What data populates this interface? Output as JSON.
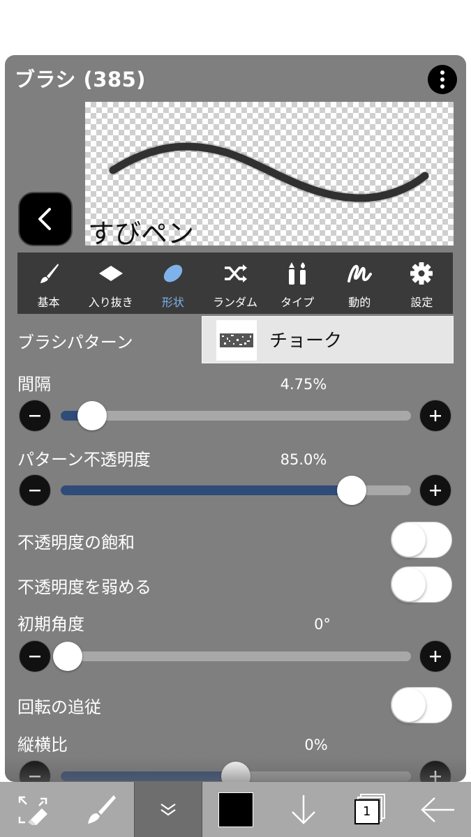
{
  "header": {
    "title": "ブラシ (385)"
  },
  "preview": {
    "brush_name": "すびペン"
  },
  "tabs": [
    {
      "label": "基本",
      "icon": "brush-icon",
      "active": false
    },
    {
      "label": "入り抜き",
      "icon": "diamond-icon",
      "active": false
    },
    {
      "label": "形状",
      "icon": "ellipse-icon",
      "active": true
    },
    {
      "label": "ランダム",
      "icon": "shuffle-icon",
      "active": false
    },
    {
      "label": "タイプ",
      "icon": "type-icon",
      "active": false
    },
    {
      "label": "動的",
      "icon": "dynamic-icon",
      "active": false
    },
    {
      "label": "設定",
      "icon": "gear-icon",
      "active": false
    }
  ],
  "brush_pattern": {
    "label": "ブラシパターン",
    "value": "チョーク"
  },
  "spacing": {
    "label": "間隔",
    "value": "4.75%",
    "level": 0.09
  },
  "pattern_opacity": {
    "label": "パターン不透明度",
    "value": "85.0%",
    "level": 0.83
  },
  "opacity_saturation": {
    "label": "不透明度の飽和",
    "on": false
  },
  "opacity_weaken": {
    "label": "不透明度を弱める",
    "on": false
  },
  "initial_angle": {
    "label": "初期角度",
    "value": "0°",
    "level": 0.02
  },
  "follow_rotation": {
    "label": "回転の追従",
    "on": false
  },
  "aspect_ratio": {
    "label": "縦横比",
    "value": "0%",
    "level": 0.5
  },
  "bottom_toolbar": {
    "layer_count": "1",
    "items": [
      "transform-icon",
      "brush-icon",
      "chevron-down-icon",
      "color-swatch",
      "arrow-down-icon",
      "layers-icon",
      "arrow-left-icon"
    ]
  },
  "colors": {
    "accent": "#7fb2ea",
    "slider_fill": "#2f4b78",
    "panel": "#7f7f7f",
    "tabbar": "#3a3a3a",
    "bottombar": "#a9a9a9"
  }
}
